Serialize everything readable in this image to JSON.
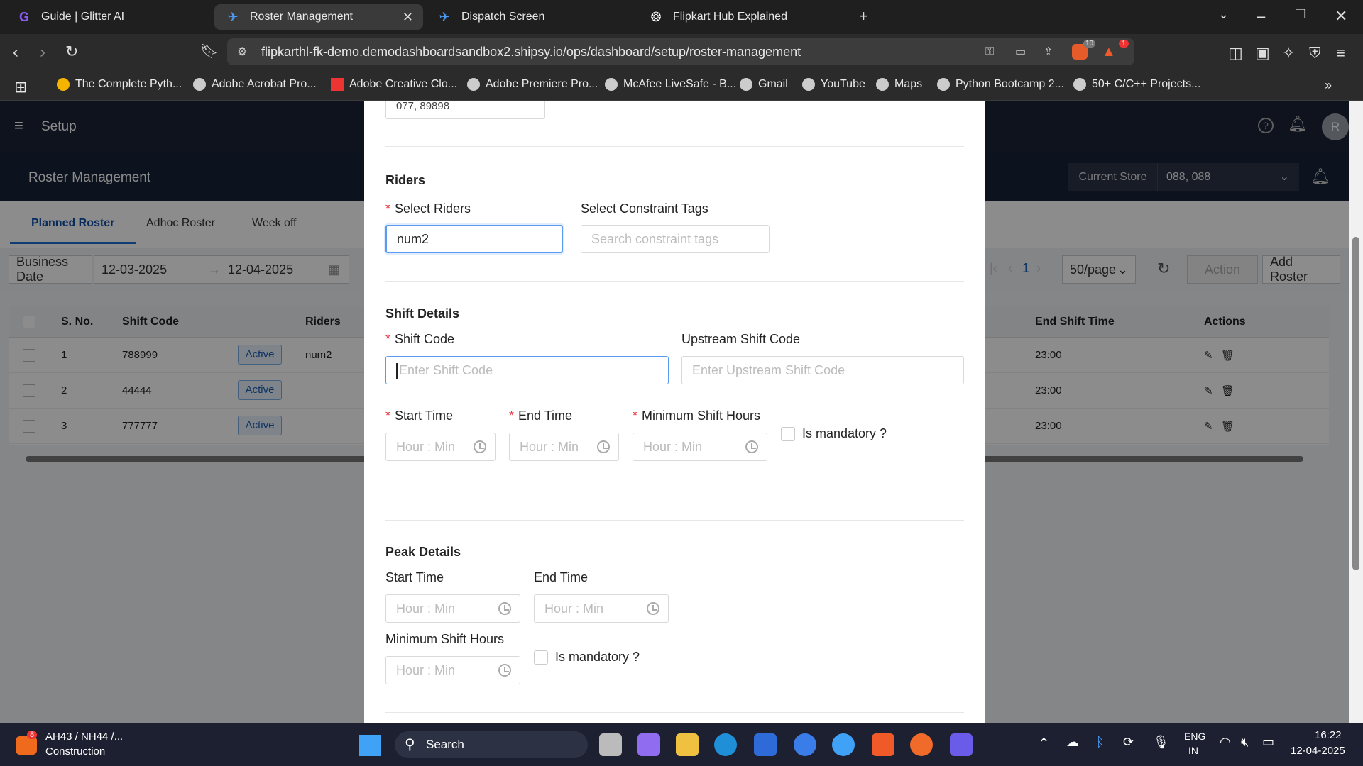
{
  "browser": {
    "tabs": [
      {
        "title": "Guide | Glitter AI",
        "active": false
      },
      {
        "title": "Roster Management",
        "active": true
      },
      {
        "title": "Dispatch Screen",
        "active": false
      },
      {
        "title": "Flipkart Hub Explained",
        "active": false
      }
    ],
    "url": "flipkarthl-fk-demo.demodashboardsandbox2.shipsy.io/ops/dashboard/setup/roster-management",
    "shield_count": "10",
    "alert_count": "1",
    "bookmarks": [
      "The Complete Pyth...",
      "Adobe Acrobat Pro...",
      "Adobe Creative Clo...",
      "Adobe Premiere Pro...",
      "McAfee LiveSafe - B...",
      "Gmail",
      "YouTube",
      "Maps",
      "Python Bootcamp 2...",
      "50+ C/C++ Projects..."
    ]
  },
  "app": {
    "nav_title": "Setup",
    "page_title": "Roster Management",
    "avatar_letter": "R",
    "current_store_label": "Current Store",
    "current_store_value": "088, 088",
    "tabs": [
      "Planned Roster",
      "Adhoc Roster",
      "Week off"
    ],
    "business_date_label": "Business Date",
    "date_from": "12-03-2025",
    "date_arrow": "→",
    "date_to": "12-04-2025",
    "page_number": "1",
    "page_size": "50/page",
    "action_label": "Action",
    "add_roster_label": "Add Roster",
    "table": {
      "headers": {
        "sno": "S. No.",
        "shift_code": "Shift Code",
        "riders": "Riders",
        "end_shift_time": "End Shift Time",
        "actions": "Actions"
      },
      "rows": [
        {
          "sno": "1",
          "shift_code": "788999",
          "status": "Active",
          "riders": "num2",
          "end": "23:00"
        },
        {
          "sno": "2",
          "shift_code": "44444",
          "status": "Active",
          "riders": "",
          "end": "23:00"
        },
        {
          "sno": "3",
          "shift_code": "777777",
          "status": "Active",
          "riders": "",
          "end": "23:00"
        }
      ]
    }
  },
  "modal": {
    "top_field_value": "077, 89898",
    "riders_section": "Riders",
    "select_riders_label": "Select Riders",
    "select_riders_value": "num2",
    "constraint_tags_label": "Select Constraint Tags",
    "constraint_tags_placeholder": "Search constraint tags",
    "shift_section": "Shift Details",
    "shift_code_label": "Shift Code",
    "shift_code_placeholder": "Enter Shift Code",
    "upstream_label": "Upstream Shift Code",
    "upstream_placeholder": "Enter Upstream Shift Code",
    "start_time_label": "Start Time",
    "end_time_label": "End Time",
    "min_hours_label": "Minimum Shift Hours",
    "time_placeholder": "Hour : Min",
    "mandatory_label": "Is mandatory ?",
    "peak_section": "Peak Details",
    "peak_start_label": "Start Time",
    "peak_end_label": "End Time",
    "peak_min_label": "Minimum Shift Hours",
    "peak_mandatory_label": "Is mandatory ?"
  },
  "taskbar": {
    "weather_badge": "8",
    "weather_title": "AH43 / NH44 /...",
    "weather_sub": "Construction",
    "search_label": "Search",
    "lang_top": "ENG",
    "lang_bottom": "IN",
    "time": "16:22",
    "date": "12-04-2025"
  }
}
